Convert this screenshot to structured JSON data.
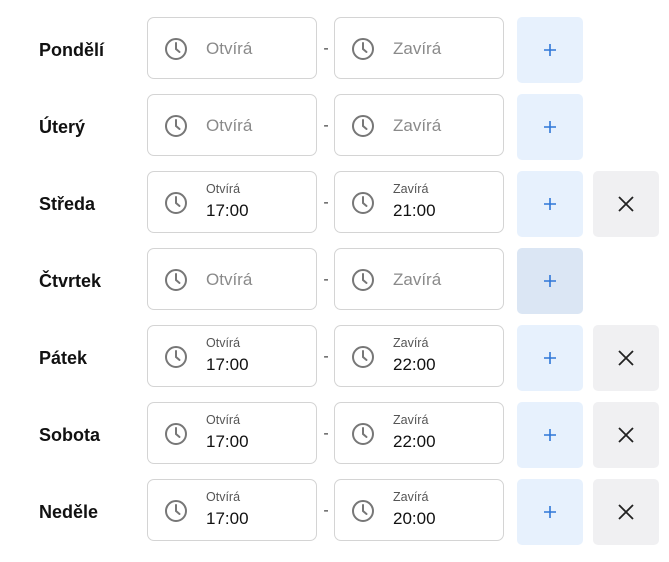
{
  "days": [
    {
      "label": "Pondělí",
      "open_placeholder": "Otvírá",
      "close_placeholder": "Zavírá",
      "open_value": "",
      "close_value": "",
      "removable": false
    },
    {
      "label": "Úterý",
      "open_placeholder": "Otvírá",
      "close_placeholder": "Zavírá",
      "open_value": "",
      "close_value": "",
      "removable": false
    },
    {
      "label": "Středa",
      "open_label": "Otvírá",
      "close_label": "Zavírá",
      "open_value": "17:00",
      "close_value": "21:00",
      "removable": true
    },
    {
      "label": "Čtvrtek",
      "open_placeholder": "Otvírá",
      "close_placeholder": "Zavírá",
      "open_value": "",
      "close_value": "",
      "removable": false
    },
    {
      "label": "Pátek",
      "open_label": "Otvírá",
      "close_label": "Zavírá",
      "open_value": "17:00",
      "close_value": "22:00",
      "removable": true
    },
    {
      "label": "Sobota",
      "open_label": "Otvírá",
      "close_label": "Zavírá",
      "open_value": "17:00",
      "close_value": "22:00",
      "removable": true
    },
    {
      "label": "Neděle",
      "open_label": "Otvírá",
      "close_label": "Zavírá",
      "open_value": "17:00",
      "close_value": "20:00",
      "removable": true
    }
  ],
  "separator": "-",
  "icons": {
    "clock": "clock-icon",
    "add": "plus-icon",
    "remove": "close-icon"
  },
  "colors": {
    "accent": "#2f77d8",
    "add_bg": "#e7f1fd",
    "remove_bg": "#f0f0f2",
    "border": "#d4d4d4"
  }
}
